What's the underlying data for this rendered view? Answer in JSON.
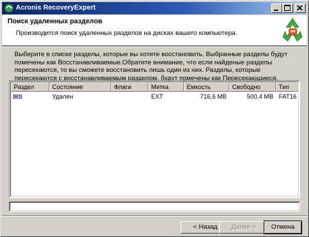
{
  "window": {
    "title": "Acronis RecoveryExpert"
  },
  "header": {
    "title": "Поиск удаленных разделов",
    "subtitle": "Производится поиск удаленных разделов на дисках вашего компьютера."
  },
  "instructions": "Выберите в списке разделы, которые вы хотите восстановить. Выбранные разделы будут помечены как Восстанавливаемые.Обратите внимание, что если найденые разделы пересекаются, то вы сможете восстановить лишь один из них. Разделы, которые пересекаются с восстанавливаемым разделом, будут помечены как Пересекающиеся.",
  "table": {
    "columns": [
      "Раздел",
      "Состояние",
      "Флаги",
      "Метка",
      "Емкость",
      "Свободно",
      "Тип"
    ],
    "rows": [
      {
        "icon": "disk-icon",
        "partition": "",
        "state": "Удален",
        "flags": "",
        "label": "EXT",
        "capacity": "716,6 MB",
        "free": "500,4 MB",
        "type": "FAT16"
      }
    ]
  },
  "status_field": {
    "value": ""
  },
  "buttons": {
    "back": "< Назад",
    "next": "Далее >",
    "cancel": "Отмена"
  }
}
